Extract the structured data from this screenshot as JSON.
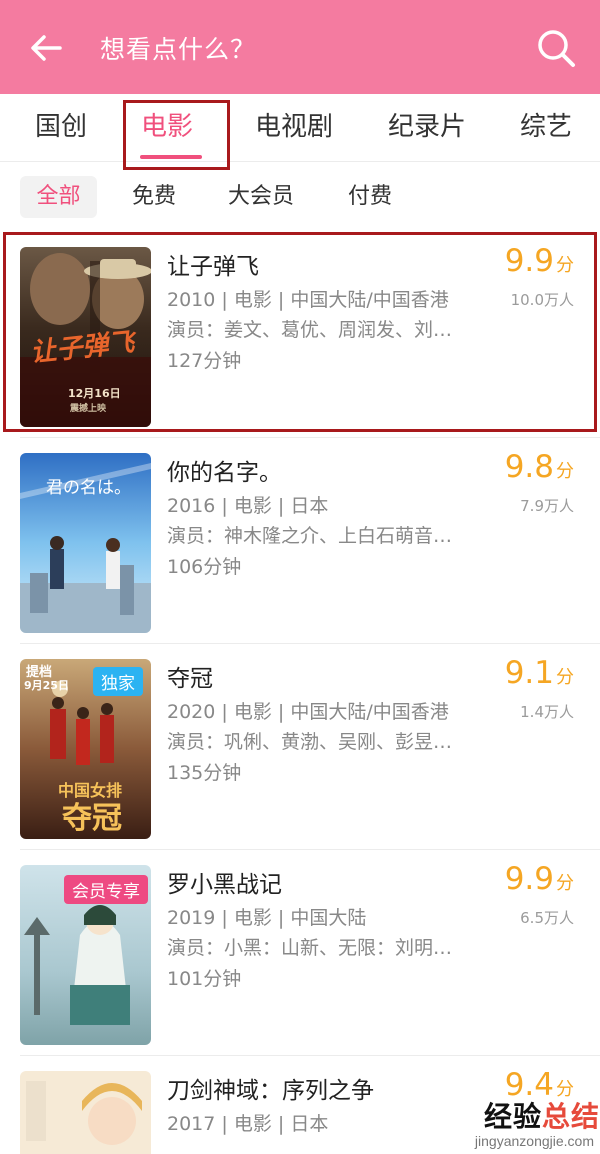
{
  "header": {
    "search_hint": "想看点什么？"
  },
  "tabs": [
    "国创",
    "电影",
    "电视剧",
    "纪录片",
    "综艺"
  ],
  "filters": [
    "全部",
    "免费",
    "大会员",
    "付费"
  ],
  "movies": [
    {
      "title": "让子弹飞",
      "meta": "2010 | 电影 | 中国大陆/中国香港",
      "cast": "演员：姜文、葛优、周润发、刘…",
      "duration": "127分钟",
      "score": "9.9",
      "score_unit": "分",
      "votes": "10.0万人",
      "poster_text": [
        "让子弹飞",
        "12月16日",
        "震撼上映"
      ]
    },
    {
      "title": "你的名字。",
      "meta": "2016 | 电影 | 日本",
      "cast": "演员：神木隆之介、上白石萌音…",
      "duration": "106分钟",
      "score": "9.8",
      "score_unit": "分",
      "votes": "7.9万人",
      "poster_text": [
        "君の名は。"
      ]
    },
    {
      "title": "夺冠",
      "meta": "2020 | 电影 | 中国大陆/中国香港",
      "cast": "演员：巩俐、黄渤、吴刚、彭昱…",
      "duration": "135分钟",
      "score": "9.1",
      "score_unit": "分",
      "votes": "1.4万人",
      "badge": "独家",
      "poster_text": [
        "提档",
        "9月25日",
        "中国女排",
        "夺冠"
      ]
    },
    {
      "title": "罗小黑战记",
      "meta": "2019 | 电影 | 中国大陆",
      "cast": "演员：小黑：山新、无限：刘明…",
      "duration": "101分钟",
      "score": "9.9",
      "score_unit": "分",
      "votes": "6.5万人",
      "badge": "会员专享"
    },
    {
      "title": "刀剑神域：序列之争",
      "meta": "2017 | 电影 | 日本",
      "score": "9.4",
      "score_unit": "分"
    }
  ],
  "watermark": {
    "part1": "经验",
    "part2": "总结",
    "sub": "jingyanzongjie.com"
  },
  "colors": {
    "brand_pink": "#f47ba0",
    "accent_pink": "#f0507d",
    "score_orange": "#f5a623",
    "highlight_red": "#a8191c"
  }
}
